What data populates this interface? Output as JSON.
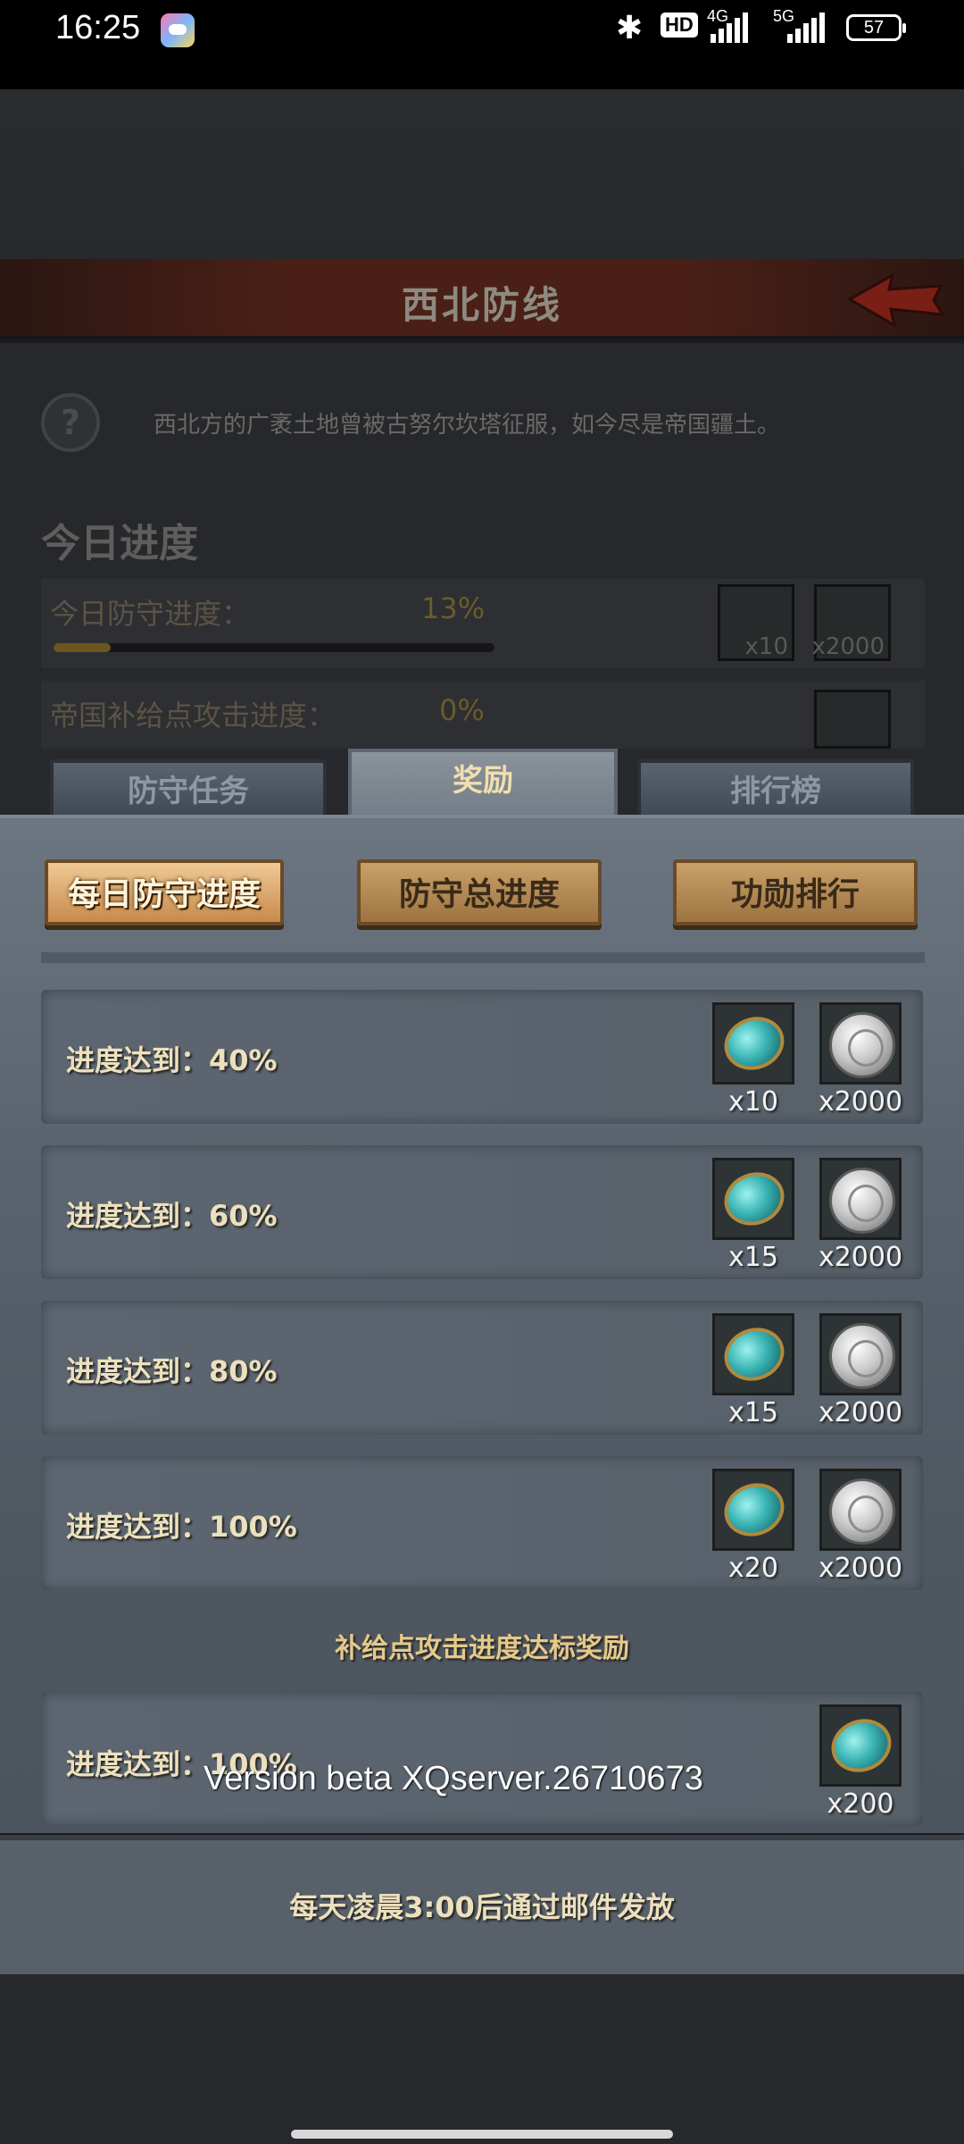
{
  "status_bar": {
    "time": "16:25",
    "network_1": "4G",
    "network_2": "5G",
    "hd_badge": "HD",
    "battery": "57",
    "icons": [
      "app-icon",
      "bluetooth-icon",
      "hd-icon",
      "signal-icon",
      "signal-icon",
      "battery-icon"
    ]
  },
  "background": {
    "title": "西北防线",
    "description": "西北方的广袤土地曾被古努尔坎塔征服，如今尽是帝国疆土。",
    "section_heading": "今日进度",
    "rows": [
      {
        "label": "今日防守进度：",
        "percent": "13%",
        "progress": 0.13,
        "rewards": [
          "x10",
          "x2000"
        ]
      },
      {
        "label": "帝国补给点攻击进度：",
        "percent": "0%",
        "progress": 0.0,
        "rewards": []
      }
    ]
  },
  "tabs": [
    {
      "label": "防守任务",
      "active": false
    },
    {
      "label": "奖励",
      "active": true
    },
    {
      "label": "排行榜",
      "active": false
    }
  ],
  "subtabs": [
    {
      "label": "每日防守进度",
      "active": true
    },
    {
      "label": "防守总进度",
      "active": false
    },
    {
      "label": "功勋排行",
      "active": false
    }
  ],
  "reward_rows": [
    {
      "label": "进度达到：40%",
      "rewards": [
        {
          "type": "gem",
          "count": "x10"
        },
        {
          "type": "coin",
          "count": "x2000"
        }
      ]
    },
    {
      "label": "进度达到：60%",
      "rewards": [
        {
          "type": "gem",
          "count": "x15"
        },
        {
          "type": "coin",
          "count": "x2000"
        }
      ]
    },
    {
      "label": "进度达到：80%",
      "rewards": [
        {
          "type": "gem",
          "count": "x15"
        },
        {
          "type": "coin",
          "count": "x2000"
        }
      ]
    },
    {
      "label": "进度达到：100%",
      "rewards": [
        {
          "type": "gem",
          "count": "x20"
        },
        {
          "type": "coin",
          "count": "x2000"
        }
      ]
    }
  ],
  "supply_section": {
    "title": "补给点攻击进度达标奖励",
    "row": {
      "label": "进度达到：100%",
      "rewards": [
        {
          "type": "gem",
          "count": "x200"
        }
      ]
    }
  },
  "version": "Version beta XQserver.26710673",
  "footer": "每天凌晨3:00后通过邮件发放",
  "colors": {
    "accent_gold": "#e6c98a",
    "subtab_active": "#f0c995",
    "panel": "#5a636d",
    "gem": "#3ab4b4"
  }
}
